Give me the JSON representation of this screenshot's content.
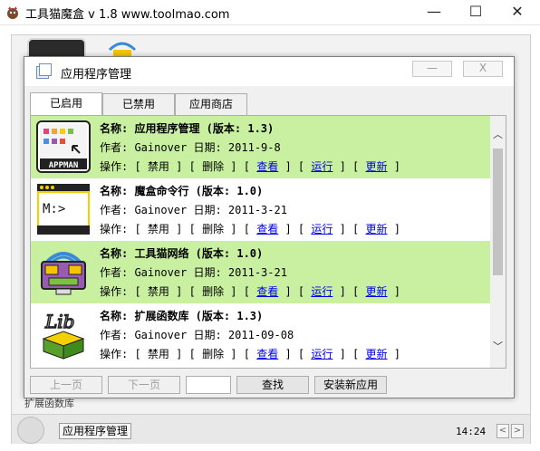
{
  "window": {
    "title": "工具猫魔盒 v 1.8 www.toolmao.com",
    "minimize": "—",
    "maximize": "☐",
    "close": "✕"
  },
  "desktop": {
    "bottom_label": "扩展函数库"
  },
  "taskbar": {
    "button_label": "应用程序管理",
    "clock": "14:24",
    "prev": "<",
    "next": ">"
  },
  "dialog": {
    "title": "应用程序管理",
    "minimize": "—",
    "close": "X",
    "tabs": [
      "已启用",
      "已禁用",
      "应用商店"
    ],
    "apps": [
      {
        "name_line": "名称: 应用程序管理 (版本: 1.3)",
        "author_line": "作者: Gainover 日期: 2011-9-8",
        "icon": "appman-icon",
        "highlight": true
      },
      {
        "name_line": "名称: 魔盒命令行 (版本: 1.0)",
        "author_line": "作者: Gainover 日期: 2011-3-21",
        "icon": "console-icon",
        "highlight": false
      },
      {
        "name_line": "名称: 工具猫网络 (版本: 1.0)",
        "author_line": "作者: Gainover 日期: 2011-3-21",
        "icon": "network-icon",
        "highlight": true
      },
      {
        "name_line": "名称: 扩展函数库 (版本: 1.3)",
        "author_line": "作者: Gainover 日期: 2011-09-08",
        "icon": "lib-icon",
        "highlight": false
      }
    ],
    "ops": {
      "label": "操作:",
      "disable": "禁用",
      "delete": "删除",
      "view": "查看",
      "run": "运行",
      "update": "更新"
    },
    "buttons": {
      "prev_page": "上一页",
      "next_page": "下一页",
      "find": "查找",
      "install": "安装新应用"
    },
    "search_value": ""
  }
}
